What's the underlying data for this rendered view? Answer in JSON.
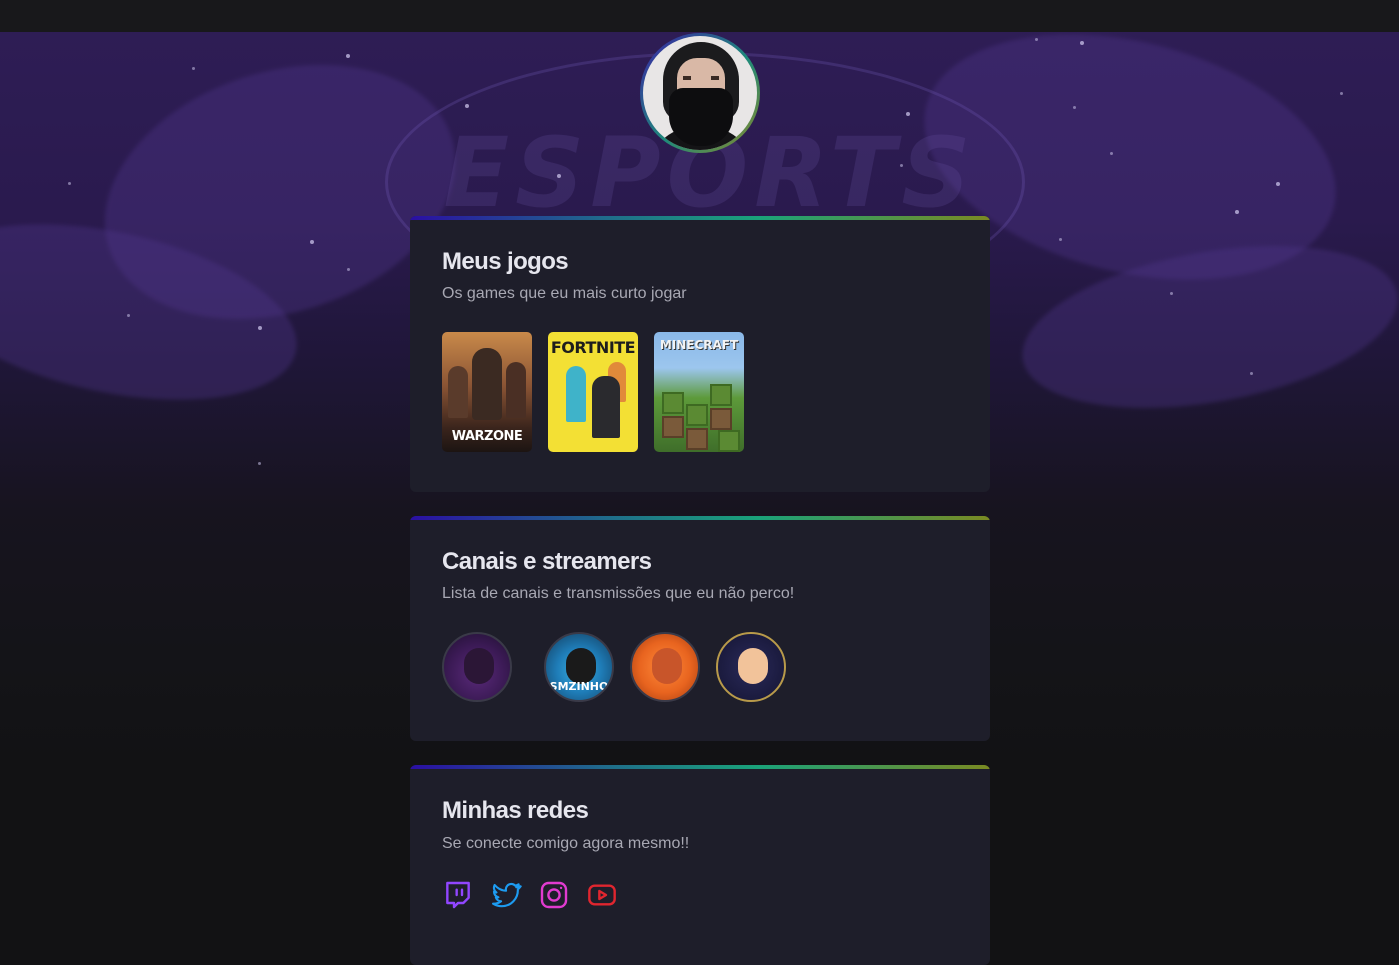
{
  "hero": {
    "watermark_text": "ESPORTS"
  },
  "profile": {
    "avatar_icon": "profile-avatar"
  },
  "games_card": {
    "title": "Meus jogos",
    "subtitle": "Os games que eu mais curto jogar",
    "games": [
      {
        "name": "WARZONE"
      },
      {
        "name": "FORTNITE"
      },
      {
        "name": "MINECRAFT"
      }
    ]
  },
  "streamers_card": {
    "title": "Canais e streamers",
    "subtitle": "Lista de canais e transmissões que eu não perco!",
    "streamers": [
      {
        "caption": ""
      },
      {
        "caption": "SMZINHO"
      },
      {
        "caption": ""
      },
      {
        "caption": ""
      }
    ]
  },
  "social_card": {
    "title": "Minhas redes",
    "subtitle": "Se conecte comigo agora mesmo!!",
    "networks": [
      {
        "icon": "twitch-icon",
        "color": "#9146ff"
      },
      {
        "icon": "twitter-icon",
        "color": "#1d9bf0"
      },
      {
        "icon": "instagram-icon",
        "color": "#e13bd0"
      },
      {
        "icon": "youtube-icon",
        "color": "#e0262f"
      }
    ]
  },
  "colors": {
    "background": "#121214",
    "card": "#1e1e2a",
    "heading": "#e6e6ee",
    "text": "#a8a8b3"
  }
}
